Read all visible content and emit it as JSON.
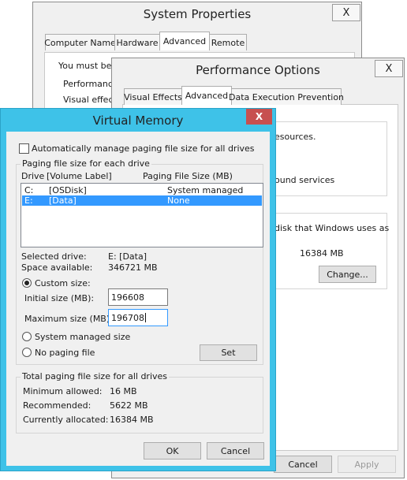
{
  "system_properties": {
    "title": "System Properties",
    "close": "X",
    "tabs": [
      {
        "label": "Computer Name"
      },
      {
        "label": "Hardware"
      },
      {
        "label": "Advanced"
      },
      {
        "label": "Remote"
      }
    ],
    "body_text": "You must be l",
    "performance_label": "Performance",
    "visual_effects_text": "Visual effect"
  },
  "performance_options": {
    "title": "Performance Options",
    "close": "X",
    "tabs": [
      {
        "label": "Visual Effects"
      },
      {
        "label": "Advanced"
      },
      {
        "label": "Data Execution Prevention"
      }
    ],
    "text_resources": "esources.",
    "text_services": "ound services",
    "text_disk": "disk that Windows uses as",
    "total_size": "16384 MB",
    "change_button": "Change...",
    "cancel_button": "Cancel",
    "apply_button": "Apply"
  },
  "virtual_memory": {
    "title": "Virtual Memory",
    "close": "X",
    "auto_manage_label": "Automatically manage paging file size for all drives",
    "auto_manage_checked": false,
    "group_label": "Paging file size for each drive",
    "col_drive": "Drive",
    "col_volume": "[Volume Label]",
    "col_size": "Paging File Size (MB)",
    "drives": [
      {
        "drive": "C:",
        "label": "[OSDisk]",
        "size": "System managed",
        "selected": false
      },
      {
        "drive": "E:",
        "label": "[Data]",
        "size": "None",
        "selected": true
      }
    ],
    "selected_drive_label": "Selected drive:",
    "selected_drive_value": "E:  [Data]",
    "space_available_label": "Space available:",
    "space_available_value": "346721 MB",
    "custom_size_label": "Custom size:",
    "initial_size_label": "Initial size (MB):",
    "initial_size_value": "196608",
    "maximum_size_label": "Maximum size (MB):",
    "maximum_size_value": "196708",
    "system_managed_label": "System managed size",
    "no_paging_label": "No paging file",
    "set_button": "Set",
    "total_group_label": "Total paging file size for all drives",
    "minimum_label": "Minimum allowed:",
    "minimum_value": "16 MB",
    "recommended_label": "Recommended:",
    "recommended_value": "5622 MB",
    "allocated_label": "Currently allocated:",
    "allocated_value": "16384 MB",
    "ok_button": "OK",
    "cancel_button": "Cancel"
  },
  "colors": {
    "vm_frame": "#3ec2e8",
    "list_selection": "#3399ff",
    "close_red": "#c75050"
  }
}
